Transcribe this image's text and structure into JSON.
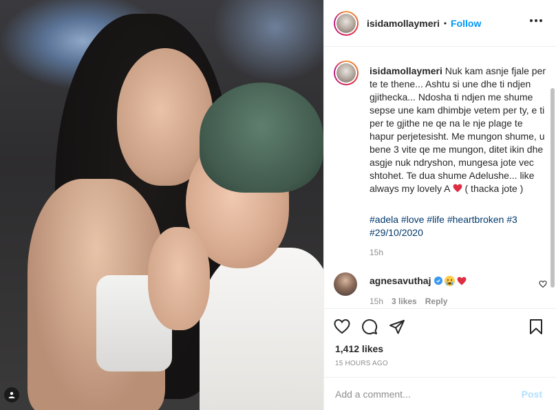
{
  "post": {
    "username": "isidamollaymeri",
    "separator": "•",
    "follow_label": "Follow"
  },
  "caption": {
    "username": "isidamollaymeri",
    "text": "Nuk kam asnje fjale per te te thene... Ashtu si une dhe ti ndjen gjithecka... Ndosha ti ndjen me shume sepse une kam dhimbje vetem per ty, e ti per te gjithe ne qe na le nje plage te hapur perjetesisht. Me mungon shume, u bene 3 vite qe me mungon, ditet ikin dhe asgje nuk ndryshon, mungesa jote vec shtohet. Te dua shume Adelushe... like always my lovely A",
    "text_after_emoji": "( thacka jote )",
    "hashtags": "#adela #love #life #heartbroken #3 #29/10/2020",
    "time": "15h"
  },
  "comment": {
    "username": "agnesavuthaj",
    "time": "15h",
    "likes": "3 likes",
    "reply_label": "Reply"
  },
  "stats": {
    "likes": "1,412 likes",
    "posted_ago": "15 HOURS AGO"
  },
  "add_comment": {
    "placeholder": "Add a comment...",
    "post_label": "Post"
  },
  "colors": {
    "link_blue": "#0095f6",
    "hashtag": "#00376b",
    "muted": "#8e8e8e",
    "heart_red": "#ed4956",
    "post_disabled": "#b2dffc"
  },
  "icons": [
    "heart-icon",
    "comment-icon",
    "share-icon",
    "bookmark-icon",
    "more-options-icon",
    "verified-icon",
    "crying-emoji-icon",
    "red-heart-emoji-icon"
  ]
}
